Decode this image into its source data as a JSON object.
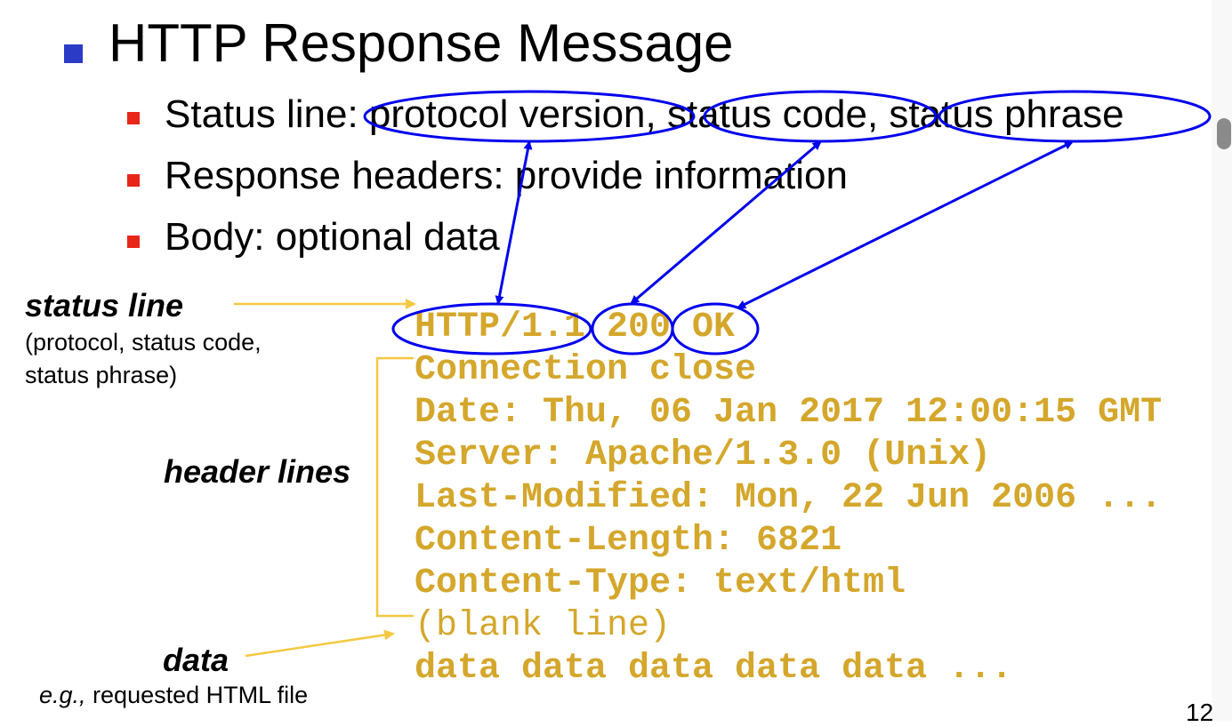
{
  "slide": {
    "title": "HTTP Response Message",
    "bullets": [
      "Status line: protocol version, status code, status phrase",
      "Response headers: provide information",
      "Body: optional data"
    ],
    "message_lines": [
      "HTTP/1.1 200 OK",
      "Connection close",
      "Date: Thu, 06 Jan 2017 12:00:15 GMT",
      "Server: Apache/1.3.0 (Unix)",
      "Last-Modified: Mon, 22 Jun 2006 ...",
      "Content-Length: 6821",
      "Content-Type: text/html",
      "(blank line)",
      "data data data data data ..."
    ],
    "labels": {
      "status_line": "status line",
      "status_line_desc1": "(protocol, status code,",
      "status_line_desc2": "status phrase)",
      "header_lines": "header lines",
      "data": "data",
      "data_desc_em": "e.g.,",
      "data_desc": " requested HTML file"
    },
    "page_number": "12",
    "colors": {
      "code": "#d4a72c",
      "annotation": "#0000ee",
      "bracket": "#f5c842",
      "bullet_main": "#2b3bc6",
      "bullet_sub": "#e8261a"
    }
  }
}
